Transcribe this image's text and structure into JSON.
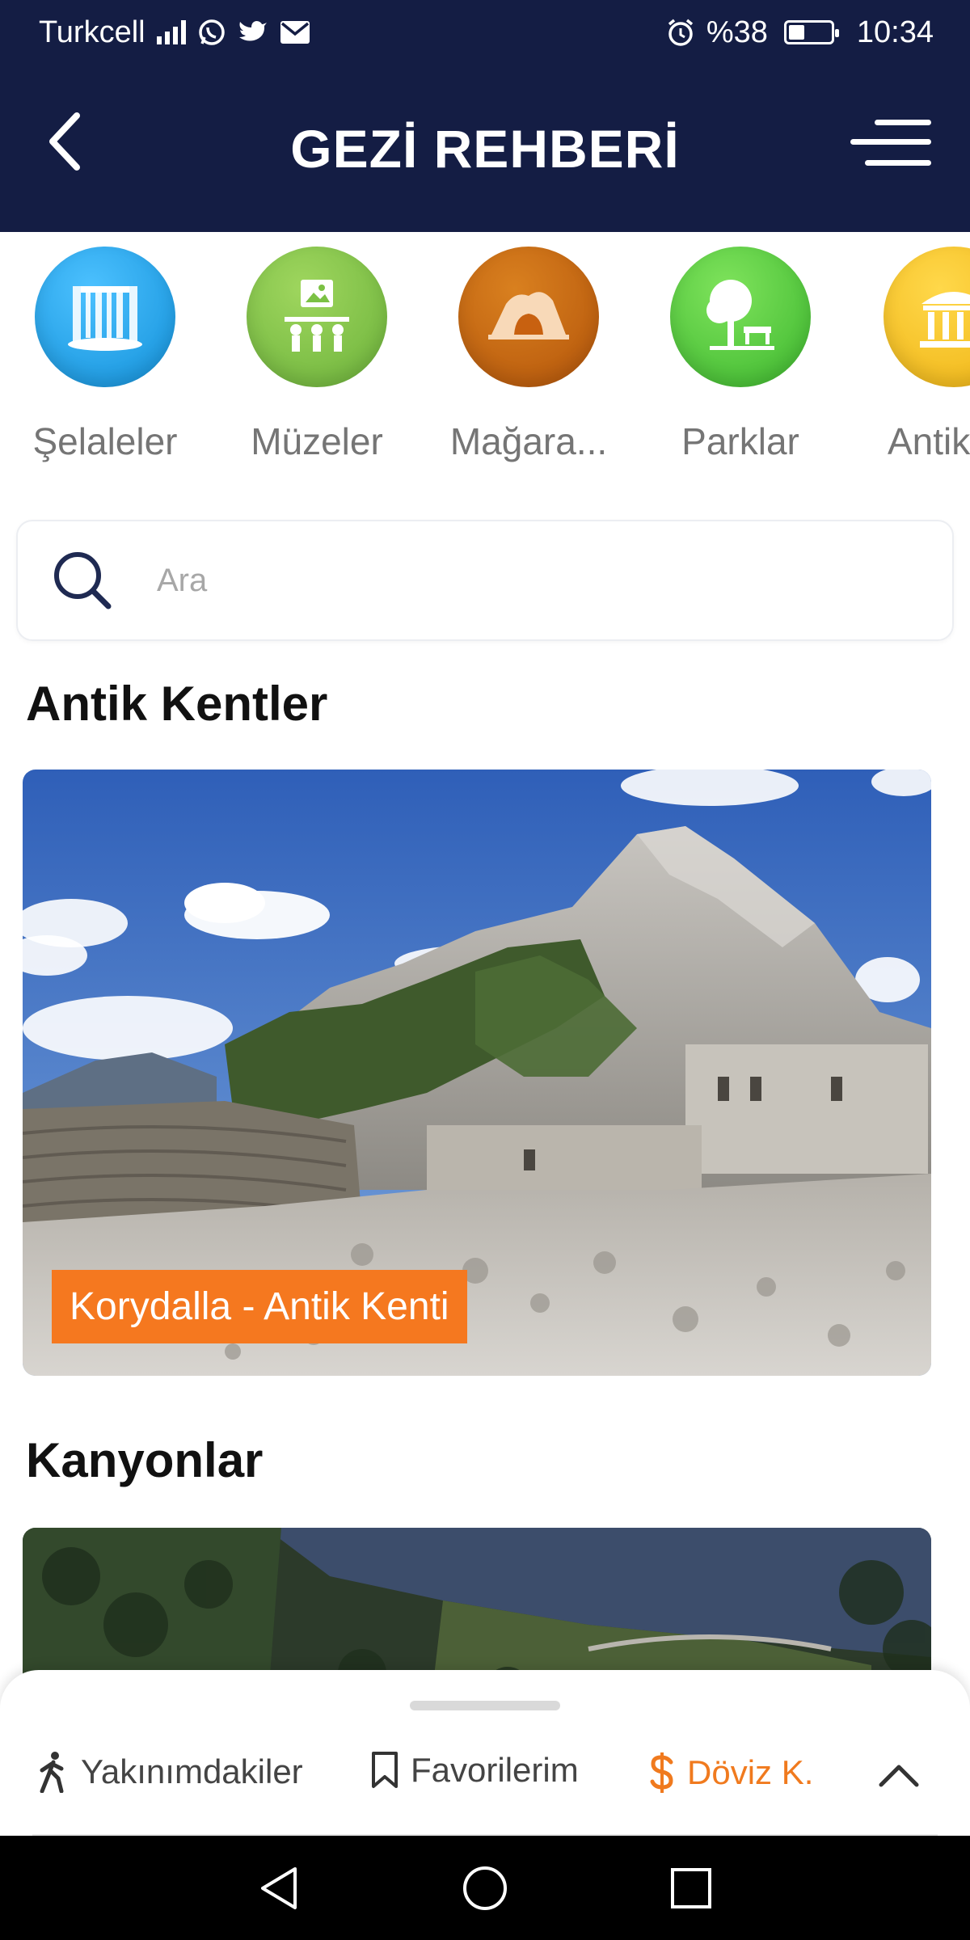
{
  "status_bar": {
    "carrier": "Turkcell",
    "battery_text": "%38",
    "battery_level": 0.38,
    "time": "10:34"
  },
  "header": {
    "title": "GEZİ REHBERİ"
  },
  "categories": [
    {
      "label": "Şelaleler",
      "icon": "waterfall-icon",
      "color": "#1ea3ea"
    },
    {
      "label": "Müzeler",
      "icon": "museum-icon",
      "color": "#7cc243"
    },
    {
      "label": "Mağara...",
      "icon": "cave-icon",
      "color": "#c56410"
    },
    {
      "label": "Parklar",
      "icon": "park-icon",
      "color": "#4fcc3a"
    },
    {
      "label": "Antik",
      "icon": "temple-icon",
      "color": "#f7c21b"
    }
  ],
  "search": {
    "placeholder": "Ara"
  },
  "sections": [
    {
      "title": "Antik Kentler",
      "card_caption": "Korydalla - Antik Kenti"
    },
    {
      "title": "Kanyonlar"
    }
  ],
  "bottom_nav": {
    "items": [
      {
        "label": "Yakınımdakiler",
        "icon": "walking-person-icon"
      },
      {
        "label": "Favorilerim",
        "icon": "bookmark-icon"
      },
      {
        "label": "Döviz K.",
        "icon": "dollar-icon"
      }
    ],
    "accent_color": "#f07a1e"
  }
}
